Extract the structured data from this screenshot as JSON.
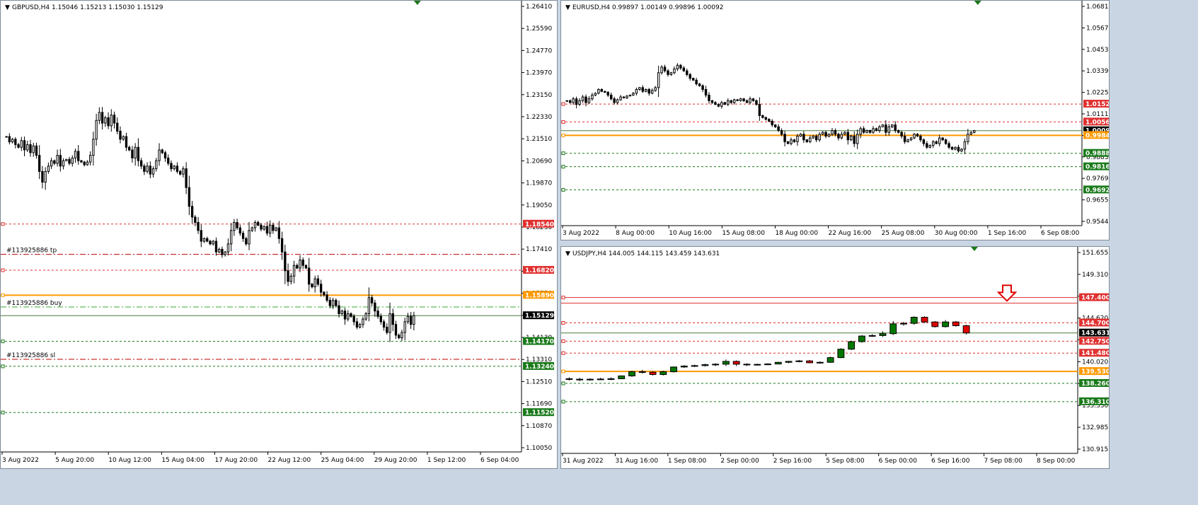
{
  "colors": {
    "bull": "#007700",
    "bear": "#e00000",
    "mono": "#000000",
    "ask_line": "#ff9900",
    "resistance": "#e03030",
    "support": "#1a7a1a",
    "last": "#4a7a3a"
  },
  "chart_data": [
    {
      "type": "candlestick",
      "symbol": "GBPUSD,H4",
      "ohlc": "1.15046 1.15213 1.15030 1.15129",
      "ylim": [
        1.1005,
        1.2686
      ],
      "y_ticks": [
        "1.26410",
        "1.25590",
        "1.24770",
        "1.23970",
        "1.23150",
        "1.22330",
        "1.21510",
        "1.20690",
        "1.19870",
        "1.19050",
        "1.18230",
        "1.17410",
        "1.16590",
        "1.15770",
        "1.14950",
        "1.14130",
        "1.13310",
        "1.12510",
        "1.11690",
        "1.10870",
        "1.10050"
      ],
      "x_ticks": [
        "3 Aug 2022",
        "5 Aug 20:00",
        "10 Aug 12:00",
        "15 Aug 04:00",
        "17 Aug 20:00",
        "22 Aug 12:00",
        "25 Aug 04:00",
        "29 Aug 20:00",
        "1 Sep 12:00",
        "6 Sep 04:00"
      ],
      "closes": [
        1.218,
        1.216,
        1.217,
        1.215,
        1.214,
        1.2165,
        1.213,
        1.215,
        1.212,
        1.2145,
        1.211,
        1.205,
        1.201,
        1.205,
        1.207,
        1.209,
        1.208,
        1.211,
        1.207,
        1.209,
        1.2095,
        1.208,
        1.21,
        1.2125,
        1.209,
        1.2085,
        1.2075,
        1.2085,
        1.211,
        1.217,
        1.224,
        1.227,
        1.223,
        1.225,
        1.222,
        1.226,
        1.223,
        1.22,
        1.217,
        1.218,
        1.214,
        1.213,
        1.21,
        1.214,
        1.209,
        1.207,
        1.205,
        1.207,
        1.204,
        1.206,
        1.209,
        1.213,
        1.212,
        1.21,
        1.208,
        1.206,
        1.207,
        1.205,
        1.204,
        1.206,
        1.199,
        1.192,
        1.188,
        1.186,
        1.183,
        1.179,
        1.18,
        1.179,
        1.178,
        1.179,
        1.175,
        1.176,
        1.174,
        1.175,
        1.178,
        1.183,
        1.186,
        1.184,
        1.182,
        1.18,
        1.178,
        1.183,
        1.184,
        1.186,
        1.185,
        1.1835,
        1.1845,
        1.182,
        1.185,
        1.183,
        1.184,
        1.18,
        1.175,
        1.168,
        1.164,
        1.166,
        1.17,
        1.169,
        1.172,
        1.17,
        1.169,
        1.163,
        1.162,
        1.165,
        1.163,
        1.16,
        1.159,
        1.157,
        1.155,
        1.157,
        1.155,
        1.152,
        1.153,
        1.15,
        1.152,
        1.151,
        1.149,
        1.147,
        1.148,
        1.15,
        1.152,
        1.158,
        1.156,
        1.153,
        1.151,
        1.149,
        1.147,
        1.145,
        1.152,
        1.148,
        1.144,
        1.143,
        1.145,
        1.149,
        1.151,
        1.148,
        1.1513
      ],
      "levels": [
        {
          "price": 1.1854,
          "label": "1.18540",
          "kind": "resistance"
        },
        {
          "price": 1.1741,
          "text": "#113925886 tp",
          "kind": "trade-red"
        },
        {
          "price": 1.1682,
          "label": "1.16820",
          "kind": "resistance"
        },
        {
          "price": 1.1589,
          "label": "1.15890",
          "kind": "ask"
        },
        {
          "price": 1.1545,
          "text": "#113925886 buy",
          "kind": "trade-green"
        },
        {
          "price": 1.15129,
          "label": "1.15129",
          "kind": "last"
        },
        {
          "price": 1.1417,
          "label": "1.14170",
          "kind": "support"
        },
        {
          "price": 1.135,
          "text": "#113925886 sl",
          "kind": "trade-red"
        },
        {
          "price": 1.1324,
          "label": "1.13240",
          "kind": "support"
        },
        {
          "price": 1.1152,
          "label": "1.11520",
          "kind": "support"
        }
      ]
    },
    {
      "type": "candlestick",
      "symbol": "EURUSD,H4",
      "ohlc": "0.99897 1.00149 0.99896 1.00092",
      "ylim": [
        0.95,
        1.0706
      ],
      "y_ticks": [
        "1.06810",
        "1.05670",
        "1.04530",
        "1.03390",
        "1.02250",
        "1.01110",
        "0.99970",
        "0.98830",
        "0.97690",
        "0.96550",
        "0.95440"
      ],
      "x_ticks": [
        "3 Aug 2022",
        "8 Aug 00:00",
        "10 Aug 16:00",
        "15 Aug 08:00",
        "18 Aug 00:00",
        "22 Aug 16:00",
        "25 Aug 08:00",
        "30 Aug 00:00",
        "1 Sep 16:00",
        "6 Sep 08:00"
      ],
      "closes": [
        1.017,
        1.016,
        1.018,
        1.015,
        1.017,
        1.019,
        1.016,
        1.018,
        1.02,
        1.021,
        1.023,
        1.022,
        1.0215,
        1.02,
        1.018,
        1.016,
        1.0175,
        1.019,
        1.0185,
        1.0195,
        1.02,
        1.021,
        1.023,
        1.024,
        1.022,
        1.023,
        1.021,
        1.0225,
        1.024,
        1.032,
        1.035,
        1.033,
        1.031,
        1.032,
        1.034,
        1.036,
        1.0345,
        1.033,
        1.031,
        1.029,
        1.028,
        1.026,
        1.025,
        1.023,
        1.02,
        1.017,
        1.016,
        1.015,
        1.014,
        1.016,
        1.015,
        1.017,
        1.016,
        1.0175,
        1.017,
        1.018,
        1.017,
        1.016,
        1.018,
        1.017,
        1.015,
        1.009,
        1.008,
        1.007,
        1.006,
        1.004,
        1.003,
        1.001,
        0.999,
        0.995,
        0.994,
        0.996,
        0.995,
        0.998,
        0.999,
        0.996,
        0.995,
        0.997,
        0.998,
        0.996,
        0.999,
        1.0,
        0.998,
        0.999,
        1.001,
        0.999,
        0.997,
        0.999,
        1.0,
        0.996,
        0.998,
        0.994,
        0.999,
        1.002,
        1.0,
        1.001,
        1.0,
        1.002,
        1.001,
        1.003,
        1.004,
        1.0,
        1.003,
        1.004,
        1.001,
        1.0,
        0.998,
        0.995,
        0.996,
        0.997,
        0.999,
        0.998,
        0.996,
        0.994,
        0.992,
        0.993,
        0.995,
        0.994,
        0.997,
        0.996,
        0.994,
        0.992,
        0.991,
        0.992,
        0.99,
        0.991,
        0.995,
        0.999,
        1.0,
        1.0009
      ],
      "levels": [
        {
          "price": 1.0152,
          "label": "1.01520",
          "kind": "resistance"
        },
        {
          "price": 1.0056,
          "label": "1.00560",
          "kind": "resistance"
        },
        {
          "price": 1.00092,
          "label": "1.00092",
          "kind": "last"
        },
        {
          "price": 0.9984,
          "label": "0.99840",
          "kind": "ask"
        },
        {
          "price": 0.9888,
          "label": "0.98880",
          "kind": "support"
        },
        {
          "price": 0.9816,
          "label": "0.98160",
          "kind": "support"
        },
        {
          "price": 0.9692,
          "label": "0.96920",
          "kind": "support"
        }
      ]
    },
    {
      "type": "candlestick",
      "symbol": "USDJPY,H4",
      "ohlc": "144.005 144.115 143.459 143.631",
      "ylim": [
        130.8,
        152.8
      ],
      "y_ticks": [
        "151.655",
        "149.310",
        "146.965",
        "144.620",
        "142.275",
        "140.020",
        "137.675",
        "135.330",
        "132.985",
        "130.915"
      ],
      "x_ticks": [
        "31 Aug 2022",
        "31 Aug 16:00",
        "1 Sep 08:00",
        "2 Sep 00:00",
        "2 Sep 16:00",
        "5 Sep 08:00",
        "6 Sep 00:00",
        "6 Sep 16:00",
        "7 Sep 08:00",
        "8 Sep 00:00"
      ],
      "candles": [
        [
          138.75,
          138.9,
          138.55,
          138.7
        ],
        [
          138.7,
          138.85,
          138.5,
          138.65
        ],
        [
          138.65,
          138.8,
          138.55,
          138.7
        ],
        [
          138.7,
          138.85,
          138.6,
          138.72
        ],
        [
          138.72,
          138.9,
          138.6,
          138.75
        ],
        [
          138.75,
          139.1,
          138.7,
          139.05
        ],
        [
          139.05,
          139.6,
          138.95,
          139.5
        ],
        [
          139.5,
          139.7,
          139.3,
          139.45
        ],
        [
          139.45,
          139.55,
          139.1,
          139.2
        ],
        [
          139.2,
          139.6,
          139.1,
          139.5
        ],
        [
          139.5,
          140.05,
          139.4,
          140.0
        ],
        [
          140.0,
          140.2,
          139.9,
          140.1
        ],
        [
          140.1,
          140.25,
          140.0,
          140.15
        ],
        [
          140.15,
          140.35,
          140.05,
          140.25
        ],
        [
          140.25,
          140.4,
          140.1,
          140.3
        ],
        [
          140.3,
          140.8,
          140.1,
          140.6
        ],
        [
          140.6,
          140.7,
          140.1,
          140.3
        ],
        [
          140.3,
          140.4,
          140.1,
          140.25
        ],
        [
          140.25,
          140.35,
          140.15,
          140.28
        ],
        [
          140.28,
          140.4,
          140.2,
          140.32
        ],
        [
          140.32,
          140.55,
          140.3,
          140.5
        ],
        [
          140.5,
          140.65,
          140.4,
          140.6
        ],
        [
          140.6,
          140.75,
          140.5,
          140.65
        ],
        [
          140.65,
          140.75,
          140.4,
          140.45
        ],
        [
          140.45,
          140.6,
          140.35,
          140.5
        ],
        [
          140.5,
          141.1,
          140.45,
          141.0
        ],
        [
          141.0,
          142.0,
          140.95,
          141.9
        ],
        [
          141.9,
          142.8,
          141.8,
          142.7
        ],
        [
          142.7,
          143.4,
          142.6,
          143.3
        ],
        [
          143.3,
          143.5,
          143.2,
          143.35
        ],
        [
          143.35,
          143.8,
          143.2,
          143.55
        ],
        [
          143.55,
          144.9,
          143.4,
          144.6
        ],
        [
          144.6,
          144.8,
          144.4,
          144.65
        ],
        [
          144.65,
          145.4,
          144.5,
          145.3
        ],
        [
          145.3,
          145.4,
          144.7,
          144.8
        ],
        [
          144.8,
          144.9,
          144.2,
          144.3
        ],
        [
          144.3,
          145.0,
          144.2,
          144.8
        ],
        [
          144.8,
          144.9,
          144.3,
          144.4
        ],
        [
          144.4,
          144.5,
          143.459,
          143.631
        ]
      ],
      "levels": [
        {
          "price": 147.4,
          "label": "147.400",
          "kind": "resistance-solid"
        },
        {
          "price": 146.8,
          "kind": "resistance-solid-thin"
        },
        {
          "price": 144.7,
          "label": "144.700",
          "kind": "resistance"
        },
        {
          "price": 143.631,
          "label": "143.631",
          "kind": "last"
        },
        {
          "price": 142.75,
          "label": "142.750",
          "kind": "resistance"
        },
        {
          "price": 141.48,
          "label": "141.480",
          "kind": "resistance"
        },
        {
          "price": 139.53,
          "label": "139.530",
          "kind": "ask"
        },
        {
          "price": 138.26,
          "label": "138.260",
          "kind": "support"
        },
        {
          "price": 136.31,
          "label": "136.310",
          "kind": "support"
        }
      ],
      "arrow": "down"
    }
  ]
}
